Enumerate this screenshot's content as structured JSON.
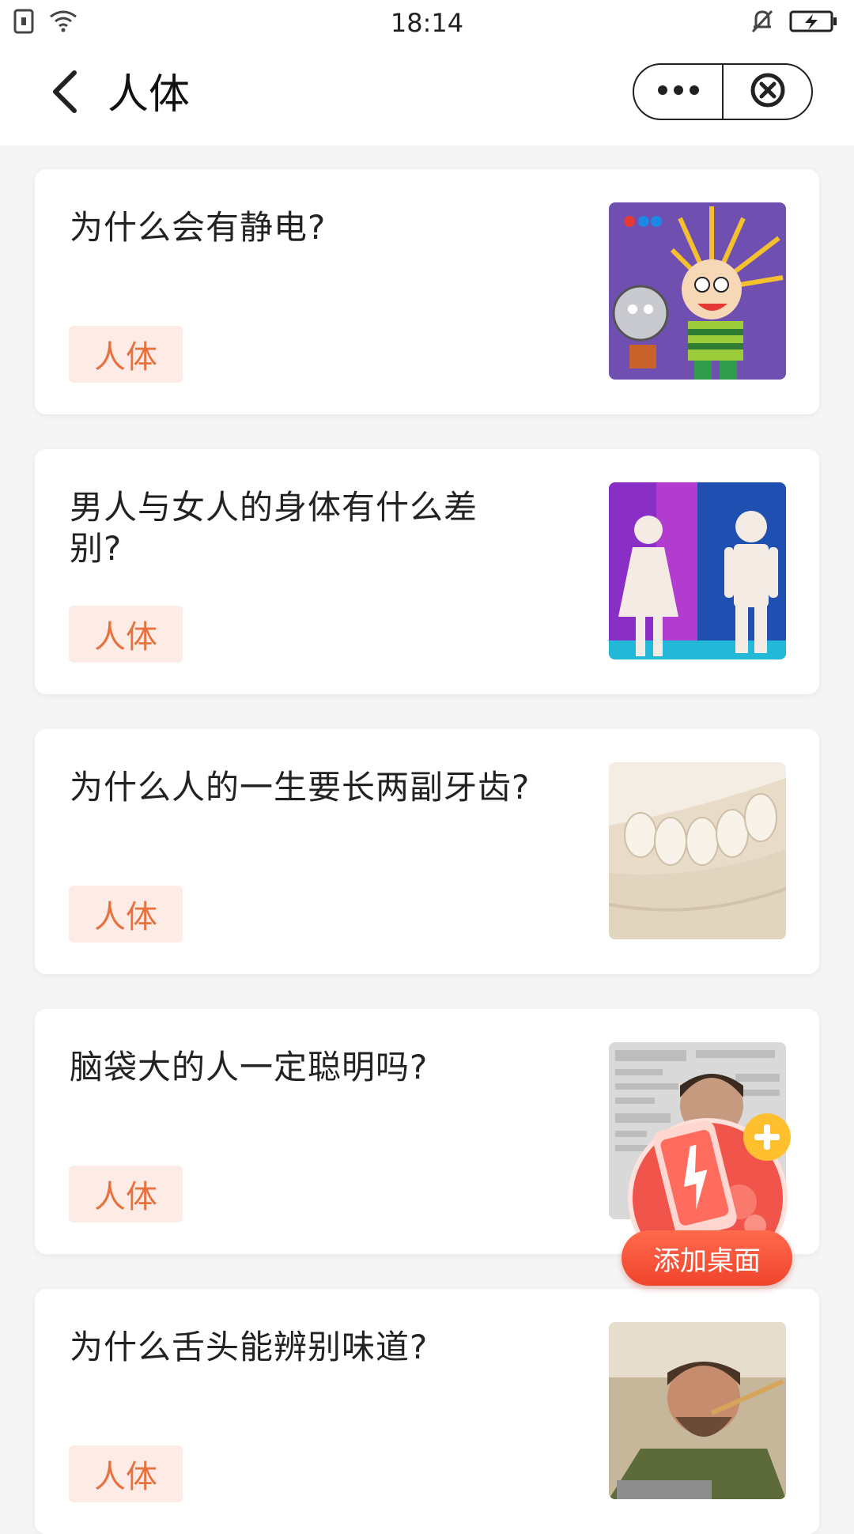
{
  "status_bar": {
    "time": "18:14",
    "icons": [
      "sim-icon",
      "wifi-icon",
      "mute-bell-icon",
      "battery-charging-icon"
    ]
  },
  "header": {
    "title": "人体",
    "back_icon": "chevron-left-icon",
    "more_icon": "more-dots-icon",
    "close_icon": "close-circle-icon"
  },
  "articles": [
    {
      "title": "为什么会有静电?",
      "tag": "人体",
      "thumb": "static-electricity-cartoon"
    },
    {
      "title": "男人与女人的身体有什么差别?",
      "tag": "人体",
      "thumb": "male-female-figures"
    },
    {
      "title": "为什么人的一生要长两副牙齿?",
      "tag": "人体",
      "thumb": "teeth-model"
    },
    {
      "title": "脑袋大的人一定聪明吗?",
      "tag": "人体",
      "thumb": "man-with-newspaper"
    },
    {
      "title": "为什么舌头能辨别味道?",
      "tag": "人体",
      "thumb": "man-tasting-food"
    }
  ],
  "floating_button": {
    "label": "添加桌面",
    "icon": "add-to-desktop-icon"
  },
  "colors": {
    "tag_text": "#e6723f",
    "tag_bg": "#fdece6",
    "fab_red": "#f0442c"
  }
}
